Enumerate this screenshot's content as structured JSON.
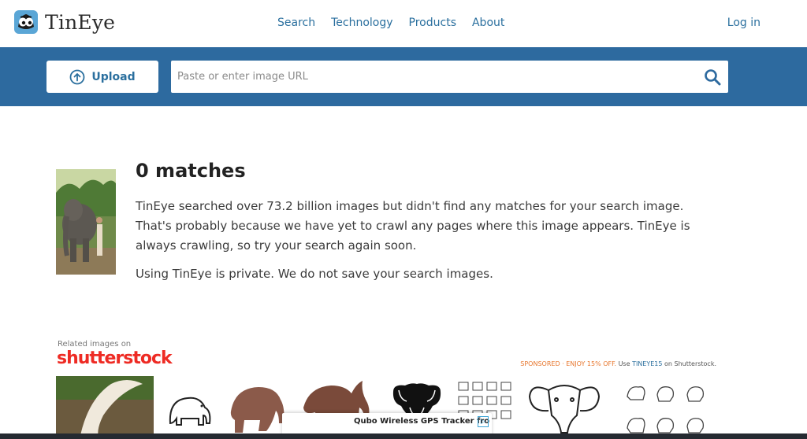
{
  "brand": {
    "name": "TinEye",
    "icon": "tineye-logo-icon"
  },
  "nav": {
    "items": [
      {
        "label": "Search"
      },
      {
        "label": "Technology"
      },
      {
        "label": "Products"
      },
      {
        "label": "About"
      }
    ],
    "login": "Log in"
  },
  "search": {
    "upload_label": "Upload",
    "upload_icon": "upload-arrow-icon",
    "url_placeholder": "Paste or enter image URL",
    "url_value": "",
    "search_icon": "magnifier-icon"
  },
  "result": {
    "title": "0 matches",
    "message": "TinEye searched over 73.2 billion images but didn't find any matches for your search image. That's probably because we have yet to crawl any pages where this image appears. TinEye is always crawling, so try your search again soon.",
    "privacy": "Using TinEye is private. We do not save your search images."
  },
  "related": {
    "label": "Related images on",
    "provider": "shutterstock",
    "sponsored": "SPONSORED · ENJOY 15% OFF.",
    "use_text": "Use",
    "code": "TINEYE15",
    "on_text": "on Shutterstock."
  },
  "ad": {
    "title": "Qubo Wireless GPS Tracker fro",
    "badge_icon": "adchoices-icon"
  },
  "colors": {
    "band": "#2d6a9f",
    "link": "#2a6f9e",
    "shutterstock_red": "#ee2b24",
    "sponsored_orange": "#e8772e"
  }
}
